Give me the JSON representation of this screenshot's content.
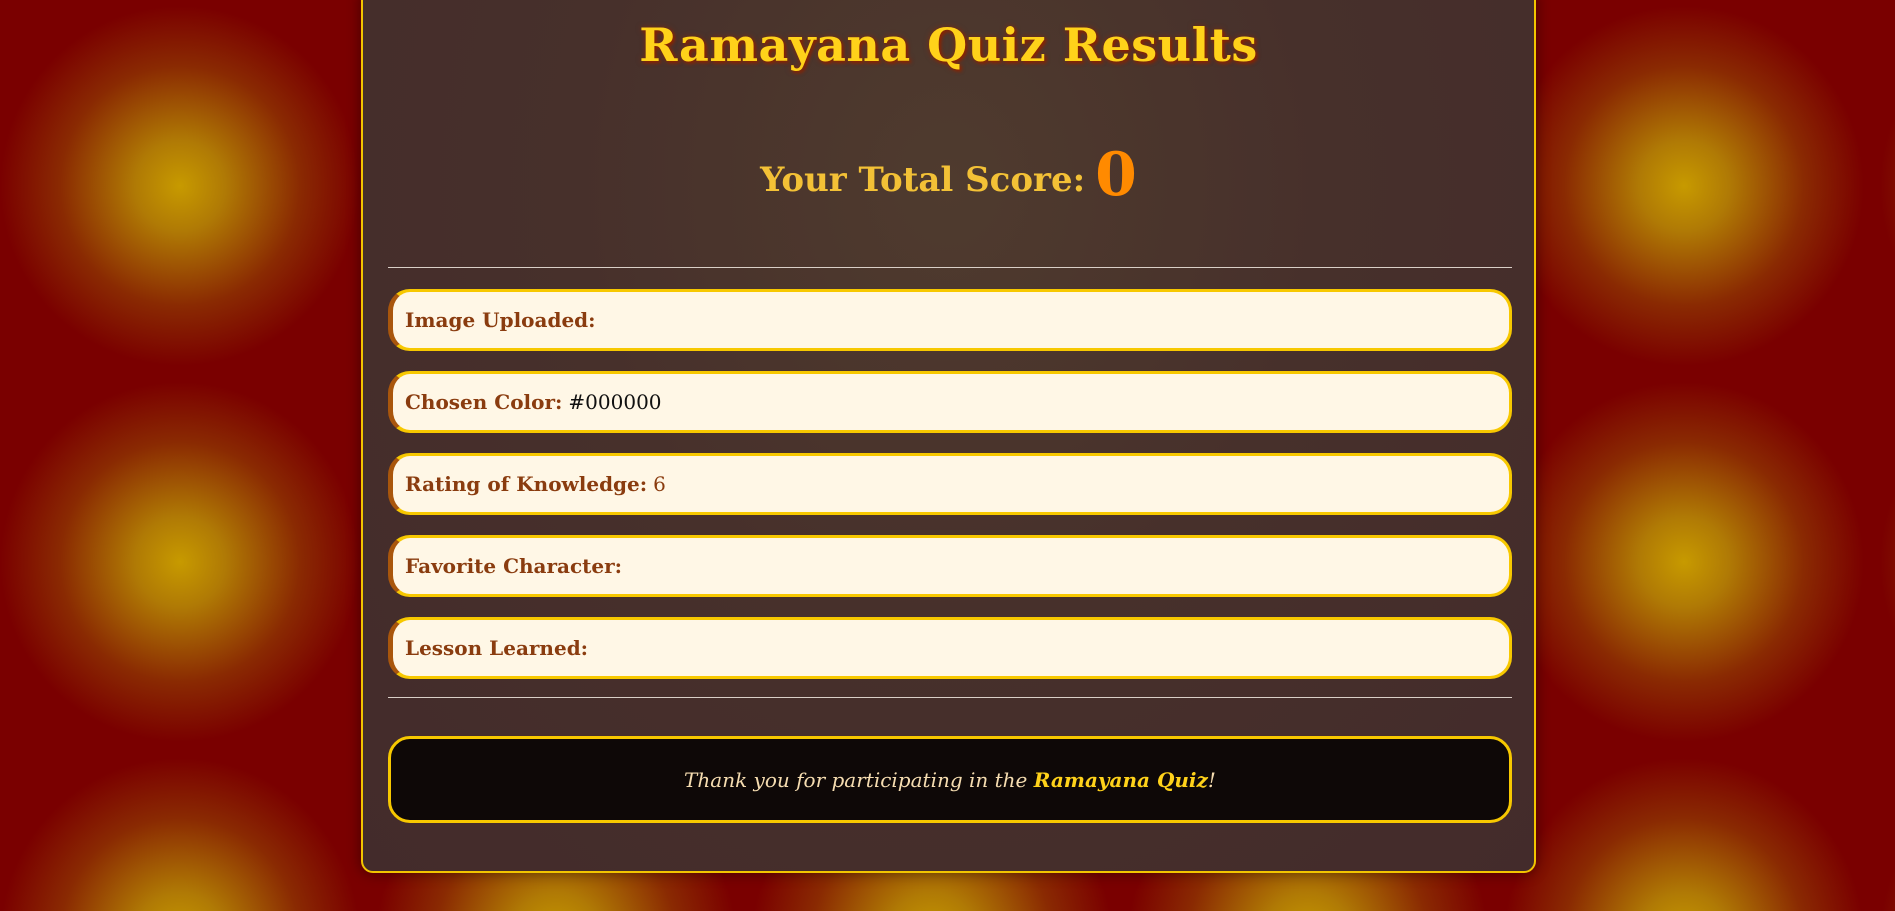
{
  "title": "Ramayana Quiz Results",
  "score": {
    "label": "Your Total Score:",
    "value": "0"
  },
  "fields": [
    {
      "label": "Image Uploaded:",
      "value": ""
    },
    {
      "label": "Chosen Color:",
      "value": "#000000"
    },
    {
      "label": "Rating of Knowledge:",
      "value": "6"
    },
    {
      "label": "Favorite Character:",
      "value": ""
    },
    {
      "label": "Lesson Learned:",
      "value": ""
    }
  ],
  "footer": {
    "prefix": "Thank you for participating in the ",
    "quiz_name": "Ramayana Quiz",
    "suffix": "!"
  },
  "colors": {
    "accent_gold": "#ffd21a",
    "score_orange": "#ff8a00",
    "label_brown": "#8a3c0f",
    "field_bg": "#fff7e6",
    "page_red": "#7a0000"
  }
}
